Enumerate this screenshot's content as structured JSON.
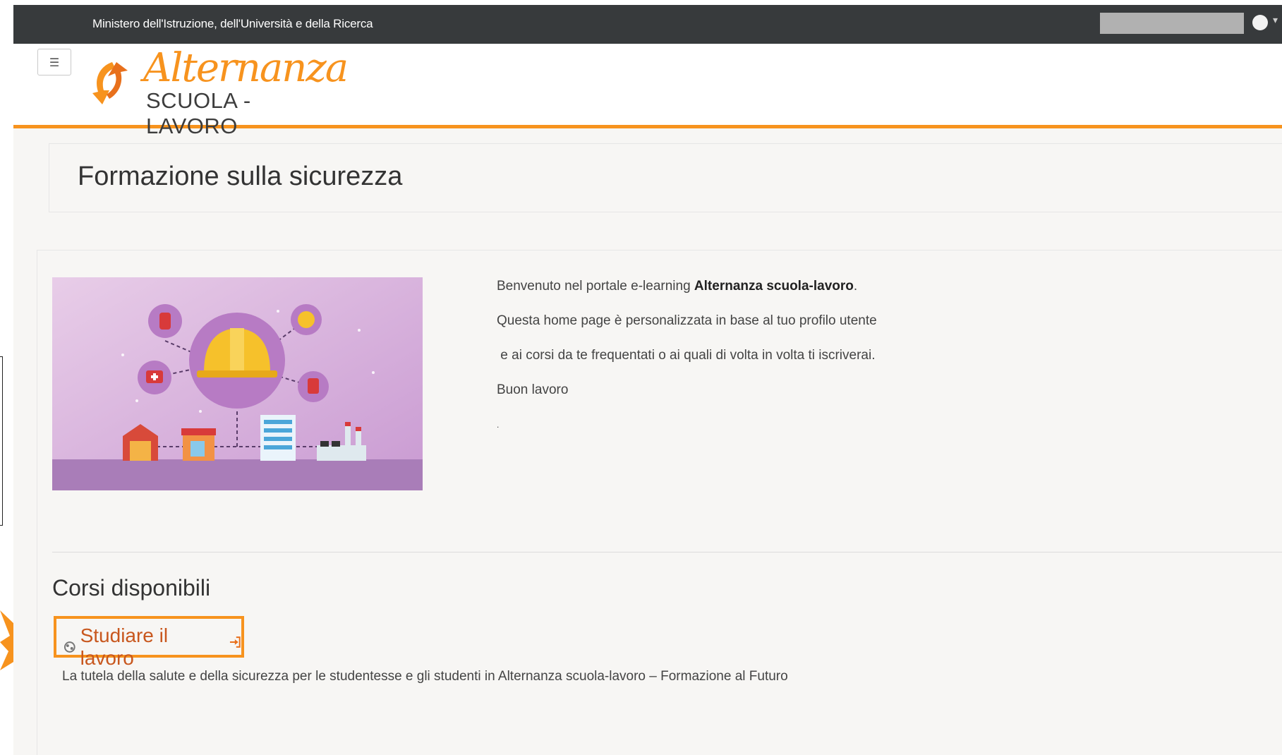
{
  "topbar": {
    "ministry": "Ministero dell'Istruzione, dell'Università e della Ricerca"
  },
  "header": {
    "menu_icon": "☰",
    "logo_script": "Alternanza",
    "logo_sub": "SCUOLA - LAVORO"
  },
  "page": {
    "title": "Formazione sulla sicurezza"
  },
  "welcome": {
    "line1_prefix": "Benvenuto nel portale e-learning ",
    "line1_bold": "Alternanza scuola-lavoro",
    "line1_suffix": ".",
    "line2": "Questa home page è personalizzata in base al tuo profilo utente",
    "line3": " e ai corsi da te frequentati o ai quali di volta in volta ti iscriverai.",
    "line4": "Buon lavoro",
    "line5": "."
  },
  "courses": {
    "heading": "Corsi disponibili",
    "items": [
      {
        "name": "Studiare il lavoro",
        "description": "La tutela della salute e della sicurezza per le studentesse e gli studenti in Alternanza scuola-lavoro – Formazione al Futuro"
      }
    ]
  },
  "colors": {
    "accent": "#f7931e",
    "link": "#c8571e",
    "topbar": "#373a3c"
  }
}
